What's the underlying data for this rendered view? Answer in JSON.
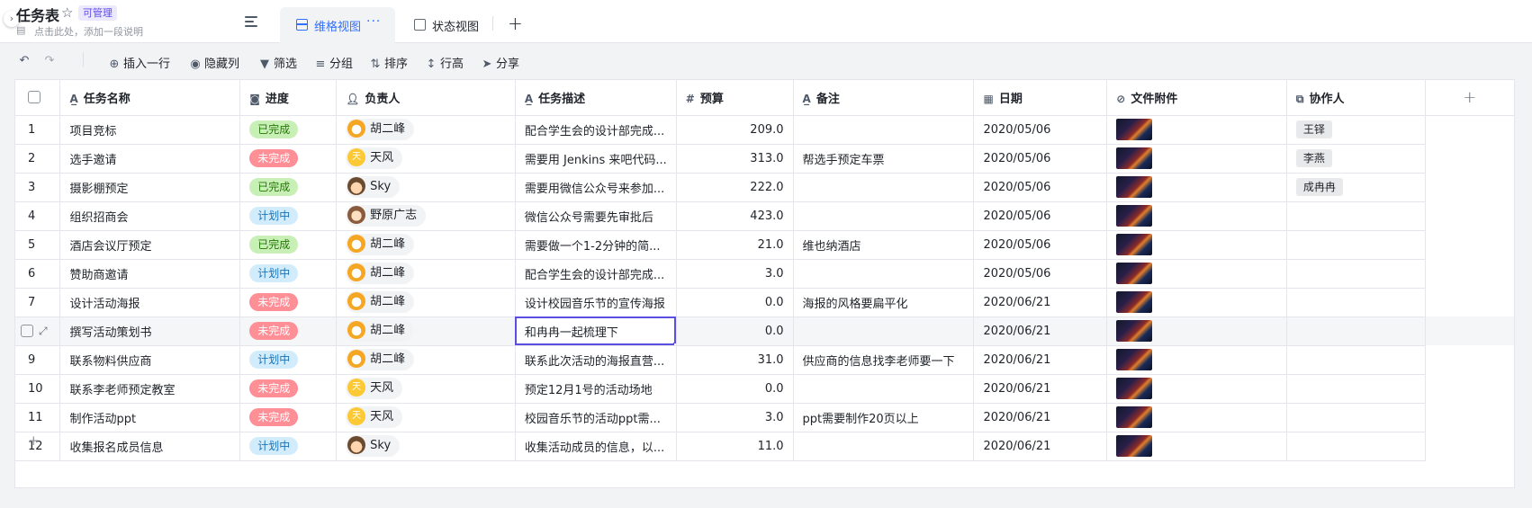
{
  "header": {
    "title": "任务表",
    "badge": "可管理",
    "description_placeholder": "点击此处，添加一段说明",
    "tabs": [
      {
        "label": "维格视图",
        "more": "···",
        "active": true
      },
      {
        "label": "状态视图",
        "active": false
      }
    ],
    "add_tab": "+"
  },
  "toolbar": {
    "insert_row": "插入一行",
    "hide_columns": "隐藏列",
    "filter": "筛选",
    "group": "分组",
    "sort": "排序",
    "row_height": "行高",
    "share": "分享"
  },
  "columns": {
    "name": "任务名称",
    "status": "进度",
    "owner": "负责人",
    "desc": "任务描述",
    "budget": "预算",
    "note": "备注",
    "date": "日期",
    "attach": "文件附件",
    "collab": "协作人",
    "add": "+"
  },
  "rows": [
    {
      "idx": "1",
      "name": "项目竞标",
      "status": "已完成",
      "status_type": "done",
      "owner": "胡二峰",
      "avatar": "hu",
      "desc": "配合学生会的设计部完成...",
      "budget": "209.0",
      "note": "",
      "date": "2020/05/06",
      "collab": "王铎"
    },
    {
      "idx": "2",
      "name": "选手邀请",
      "status": "未完成",
      "status_type": "no",
      "owner": "天风",
      "avatar": "tian",
      "desc": "需要用 Jenkins 来吧代码...",
      "budget": "313.0",
      "note": "帮选手预定车票",
      "date": "2020/05/06",
      "collab": "李燕"
    },
    {
      "idx": "3",
      "name": "摄影棚预定",
      "status": "已完成",
      "status_type": "done",
      "owner": "Sky",
      "avatar": "sky",
      "desc": "需要用微信公众号来参加...",
      "budget": "222.0",
      "note": "",
      "date": "2020/05/06",
      "collab": "成冉冉"
    },
    {
      "idx": "4",
      "name": "组织招商会",
      "status": "计划中",
      "status_type": "plan",
      "owner": "野原广志",
      "avatar": "ye",
      "desc": "微信公众号需要先审批后",
      "budget": "423.0",
      "note": "",
      "date": "2020/05/06",
      "collab": ""
    },
    {
      "idx": "5",
      "name": "酒店会议厅预定",
      "status": "已完成",
      "status_type": "done",
      "owner": "胡二峰",
      "avatar": "hu",
      "desc": "需要做一个1-2分钟的简...",
      "budget": "21.0",
      "note": "维也纳酒店",
      "date": "2020/05/06",
      "collab": ""
    },
    {
      "idx": "6",
      "name": "赞助商邀请",
      "status": "计划中",
      "status_type": "plan",
      "owner": "胡二峰",
      "avatar": "hu",
      "desc": "配合学生会的设计部完成...",
      "budget": "3.0",
      "note": "",
      "date": "2020/05/06",
      "collab": ""
    },
    {
      "idx": "7",
      "name": "设计活动海报",
      "status": "未完成",
      "status_type": "no",
      "owner": "胡二峰",
      "avatar": "hu",
      "desc": "设计校园音乐节的宣传海报",
      "budget": "0.0",
      "note": "海报的风格要扁平化",
      "date": "2020/06/21",
      "collab": ""
    },
    {
      "idx": "",
      "name": "撰写活动策划书",
      "status": "未完成",
      "status_type": "no",
      "owner": "胡二峰",
      "avatar": "hu",
      "desc": "和冉冉一起梳理下",
      "budget": "0.0",
      "note": "",
      "date": "2020/06/21",
      "collab": ""
    },
    {
      "idx": "9",
      "name": "联系物料供应商",
      "status": "计划中",
      "status_type": "plan",
      "owner": "胡二峰",
      "avatar": "hu",
      "desc": "联系此次活动的海报直营...",
      "budget": "31.0",
      "note": "供应商的信息找李老师要一下",
      "date": "2020/06/21",
      "collab": ""
    },
    {
      "idx": "10",
      "name": "联系李老师预定教室",
      "status": "未完成",
      "status_type": "no",
      "owner": "天风",
      "avatar": "tian",
      "desc": "预定12月1号的活动场地",
      "budget": "0.0",
      "note": "",
      "date": "2020/06/21",
      "collab": ""
    },
    {
      "idx": "11",
      "name": "制作活动ppt",
      "status": "未完成",
      "status_type": "no",
      "owner": "天风",
      "avatar": "tian",
      "desc": "校园音乐节的活动ppt需...",
      "budget": "3.0",
      "note": "ppt需要制作20页以上",
      "date": "2020/06/21",
      "collab": ""
    },
    {
      "idx": "12",
      "name": "收集报名成员信息",
      "status": "计划中",
      "status_type": "plan",
      "owner": "Sky",
      "avatar": "sky",
      "desc": "收集活动成员的信息，以...",
      "budget": "11.0",
      "note": "",
      "date": "2020/06/21",
      "collab": ""
    }
  ],
  "add_row": "+"
}
